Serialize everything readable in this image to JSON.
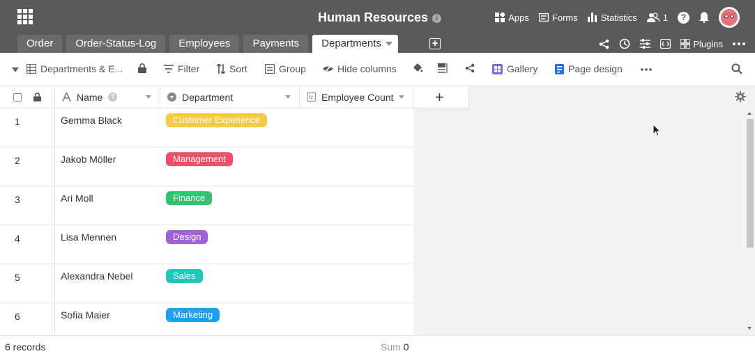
{
  "header": {
    "title": "Human Resources",
    "items": {
      "apps": "Apps",
      "forms": "Forms",
      "statistics": "Statistics",
      "collaborators": "1"
    }
  },
  "tabs": [
    "Order",
    "Order-Status-Log",
    "Employees",
    "Payments",
    "Departments"
  ],
  "tab_right": {
    "plugins": "Plugins"
  },
  "toolbar": {
    "view": "Departments & E...",
    "filter": "Filter",
    "sort": "Sort",
    "group": "Group",
    "hide_columns": "Hide columns",
    "gallery": "Gallery",
    "page_design": "Page design"
  },
  "columns": {
    "name": "Name",
    "department": "Department",
    "employee_count": "Employee Count"
  },
  "rows": [
    {
      "num": "1",
      "name": "Gemma Black",
      "dept": "Customer Experience",
      "color": "#f9c846"
    },
    {
      "num": "2",
      "name": "Jakob Möller",
      "dept": "Management",
      "color": "#ef5068"
    },
    {
      "num": "3",
      "name": "Ari Moll",
      "dept": "Finance",
      "color": "#2fc46d"
    },
    {
      "num": "4",
      "name": "Lisa Mennen",
      "dept": "Design",
      "color": "#a160d8"
    },
    {
      "num": "5",
      "name": "Alexandra Nebel",
      "dept": "Sales",
      "color": "#1ccabc"
    },
    {
      "num": "6",
      "name": "Sofia Maier",
      "dept": "Marketing",
      "color": "#1ca0f0"
    }
  ],
  "footer": {
    "records": "6 records",
    "sum_label": "Sum",
    "sum_value": "0"
  }
}
